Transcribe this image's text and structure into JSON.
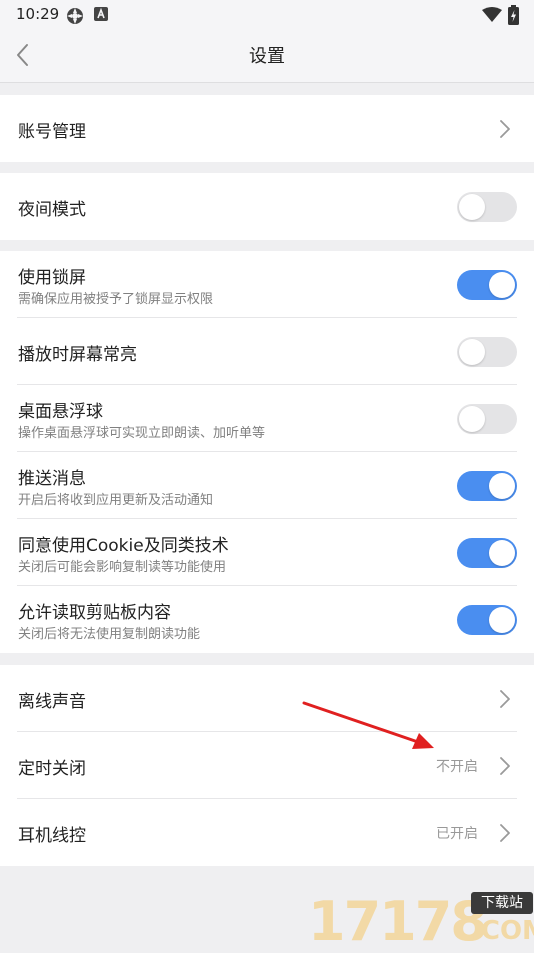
{
  "status": {
    "time": "10:29"
  },
  "header": {
    "title": "设置"
  },
  "account": {
    "label": "账号管理"
  },
  "night": {
    "label": "夜间模式",
    "on": false
  },
  "toggles": [
    {
      "label": "使用锁屏",
      "sub": "需确保应用被授予了锁屏显示权限",
      "on": true
    },
    {
      "label": "播放时屏幕常亮",
      "sub": "",
      "on": false
    },
    {
      "label": "桌面悬浮球",
      "sub": "操作桌面悬浮球可实现立即朗读、加听单等",
      "on": false
    },
    {
      "label": "推送消息",
      "sub": "开启后将收到应用更新及活动通知",
      "on": true
    },
    {
      "label": "同意使用Cookie及同类技术",
      "sub": "关闭后可能会影响复制读等功能使用",
      "on": true
    },
    {
      "label": "允许读取剪贴板内容",
      "sub": "关闭后将无法使用复制朗读功能",
      "on": true
    }
  ],
  "nav_rows": [
    {
      "label": "离线声音",
      "value": ""
    },
    {
      "label": "定时关闭",
      "value": "不开启"
    },
    {
      "label": "耳机线控",
      "value": "已开启"
    }
  ],
  "watermark": {
    "digits": "17178",
    "box": "下载站",
    "com": ".COM"
  },
  "colors": {
    "toggle_on": "#4a8ef0",
    "toggle_off": "#e4e4e6",
    "arrow": "#e02020"
  }
}
